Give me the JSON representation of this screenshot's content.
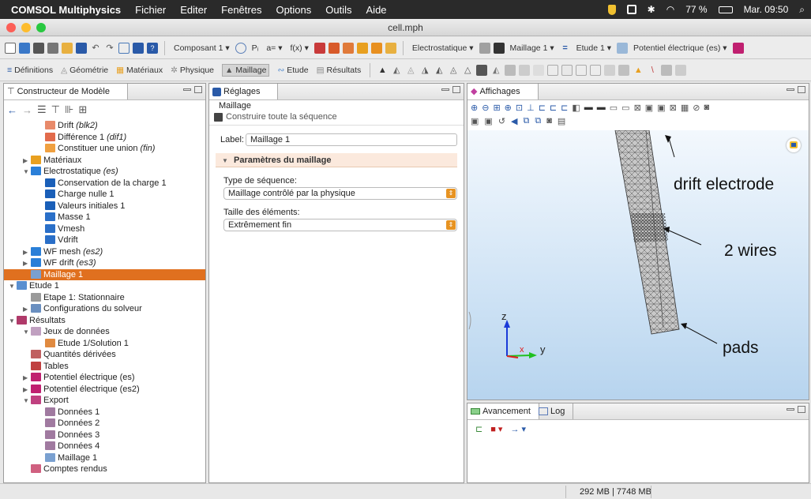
{
  "menubar": {
    "app": "COMSOL Multiphysics",
    "items": [
      "Fichier",
      "Editer",
      "Fenêtres",
      "Options",
      "Outils",
      "Aide"
    ],
    "battery": "77 %",
    "clock": "Mar. 09:50"
  },
  "window": {
    "title": "cell.mph"
  },
  "toolbar1": {
    "component": "Composant 1",
    "params": "Pᵢ",
    "params2": "a=",
    "funcs": "f(x)",
    "physics": "Electrostatique",
    "mesh": "Maillage 1",
    "study": "Etude 1",
    "result": "Potentiel électrique (es)"
  },
  "toolbar2": {
    "items": [
      "Définitions",
      "Géométrie",
      "Matériaux",
      "Physique",
      "Maillage",
      "Etude",
      "Résultats"
    ]
  },
  "model_builder": {
    "title": "Constructeur de Modèle",
    "tree": [
      {
        "label": "Drift",
        "tag": "(blk2)",
        "indent": 4,
        "icon": "#e88a6a"
      },
      {
        "label": "Différence 1",
        "tag": "(dif1)",
        "indent": 4,
        "icon": "#e26b4c"
      },
      {
        "label": "Constituer une union",
        "tag": "(fin)",
        "indent": 4,
        "icon": "#f0a040"
      },
      {
        "label": "Matériaux",
        "tag": "",
        "indent": 2,
        "icon": "#e8a020",
        "arrow": "▶"
      },
      {
        "label": "Electrostatique",
        "tag": "(es)",
        "indent": 2,
        "icon": "#2a7fd8",
        "arrow": "▼"
      },
      {
        "label": "Conservation de la charge 1",
        "tag": "",
        "indent": 4,
        "icon": "#1a5fb8"
      },
      {
        "label": "Charge nulle 1",
        "tag": "",
        "indent": 4,
        "icon": "#1a5fb8"
      },
      {
        "label": "Valeurs initiales 1",
        "tag": "",
        "indent": 4,
        "icon": "#1a5fb8"
      },
      {
        "label": "Masse 1",
        "tag": "",
        "indent": 4,
        "icon": "#2a6fc8"
      },
      {
        "label": "Vmesh",
        "tag": "",
        "indent": 4,
        "icon": "#2a6fc8"
      },
      {
        "label": "Vdrift",
        "tag": "",
        "indent": 4,
        "icon": "#2a6fc8"
      },
      {
        "label": "WF mesh",
        "tag": "(es2)",
        "indent": 2,
        "icon": "#2a7fd8",
        "arrow": "▶"
      },
      {
        "label": "WF drift",
        "tag": "(es3)",
        "indent": 2,
        "icon": "#2a7fd8",
        "arrow": "▶"
      },
      {
        "label": "Maillage 1",
        "tag": "",
        "indent": 2,
        "icon": "#7aa0d0",
        "selected": true
      },
      {
        "label": "Etude 1",
        "tag": "",
        "indent": 0,
        "icon": "#5a8fd0",
        "arrow": "▼"
      },
      {
        "label": "Etape 1: Stationnaire",
        "tag": "",
        "indent": 2,
        "icon": "#9a9a9a"
      },
      {
        "label": "Configurations du solveur",
        "tag": "",
        "indent": 2,
        "icon": "#6a8fc0",
        "arrow": "▶"
      },
      {
        "label": "Résultats",
        "tag": "",
        "indent": 0,
        "icon": "#b03a6a",
        "arrow": "▼"
      },
      {
        "label": "Jeux de données",
        "tag": "",
        "indent": 2,
        "icon": "#c0a0c0",
        "arrow": "▼"
      },
      {
        "label": "Etude 1/Solution 1",
        "tag": "",
        "indent": 4,
        "icon": "#e08a40"
      },
      {
        "label": "Quantités dérivées",
        "tag": "",
        "indent": 2,
        "icon": "#c06060"
      },
      {
        "label": "Tables",
        "tag": "",
        "indent": 2,
        "icon": "#c04040"
      },
      {
        "label": "Potentiel électrique (es)",
        "tag": "",
        "indent": 2,
        "icon": "#c02070",
        "arrow": "▶"
      },
      {
        "label": "Potentiel électrique (es2)",
        "tag": "",
        "indent": 2,
        "icon": "#c02070",
        "arrow": "▶"
      },
      {
        "label": "Export",
        "tag": "",
        "indent": 2,
        "icon": "#c04080",
        "arrow": "▼"
      },
      {
        "label": "Données 1",
        "tag": "",
        "indent": 4,
        "icon": "#a07aa0"
      },
      {
        "label": "Données 2",
        "tag": "",
        "indent": 4,
        "icon": "#a07aa0"
      },
      {
        "label": "Données 3",
        "tag": "",
        "indent": 4,
        "icon": "#a07aa0"
      },
      {
        "label": "Données 4",
        "tag": "",
        "indent": 4,
        "icon": "#a07aa0"
      },
      {
        "label": "Maillage 1",
        "tag": "",
        "indent": 4,
        "icon": "#7aa0d0"
      },
      {
        "label": "Comptes rendus",
        "tag": "",
        "indent": 2,
        "icon": "#d06080"
      }
    ]
  },
  "settings": {
    "title": "Réglages",
    "subtitle": "Maillage",
    "build_all": "Construire toute la séquence",
    "label_caption": "Label:",
    "label_value": "Maillage 1",
    "section": "Paramètres du maillage",
    "seq_type_caption": "Type de séquence:",
    "seq_type_value": "Maillage contrôlé par la physique",
    "size_caption": "Taille des éléments:",
    "size_value": "Extrêmement fin"
  },
  "graphics": {
    "title": "Affichages",
    "annotations": {
      "drift": "drift electrode",
      "wires": "2 wires",
      "pads": "pads"
    },
    "axes": {
      "z": "z",
      "x": "x",
      "y": "y"
    }
  },
  "bottom": {
    "tab_progress": "Avancement",
    "tab_log": "Log"
  },
  "status": {
    "memory": "292 MB | 7748 MB"
  }
}
